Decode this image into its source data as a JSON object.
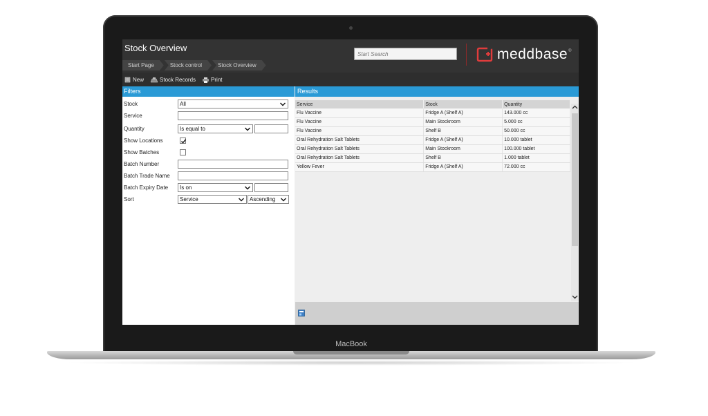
{
  "device": {
    "brand": "MacBook"
  },
  "header": {
    "title": "Stock Overview",
    "breadcrumb": [
      "Start Page",
      "Stock control",
      "Stock Overview"
    ],
    "search_placeholder": "Start Search",
    "logo_text": "meddbase",
    "logo_reg": "®",
    "accent_color": "#e03c3c"
  },
  "toolbar": {
    "new_label": "New",
    "stock_records_label": "Stock Records",
    "print_label": "Print"
  },
  "filters": {
    "title": "Filters",
    "stock": {
      "label": "Stock",
      "value": "All"
    },
    "service": {
      "label": "Service",
      "value": ""
    },
    "quantity": {
      "label": "Quantity",
      "operator": "Is equal to",
      "value": ""
    },
    "show_locations": {
      "label": "Show Locations",
      "checked": true
    },
    "show_batches": {
      "label": "Show Batches",
      "checked": false
    },
    "batch_number": {
      "label": "Batch Number",
      "value": ""
    },
    "batch_trade_name": {
      "label": "Batch Trade Name",
      "value": ""
    },
    "batch_expiry_date": {
      "label": "Batch Expiry Date",
      "operator": "Is on",
      "value": ""
    },
    "sort": {
      "label": "Sort",
      "field": "Service",
      "direction": "Ascending"
    }
  },
  "results": {
    "title": "Results",
    "columns": [
      "Service",
      "Stock",
      "Quantity"
    ],
    "rows": [
      [
        "Flu Vaccine",
        "Fridge A (Shelf A)",
        "143.000 cc"
      ],
      [
        "Flu Vaccine",
        "Main Stockroom",
        "5.000 cc"
      ],
      [
        "Flu Vaccine",
        "Shelf B",
        "50.000 cc"
      ],
      [
        "Oral Rehydration Salt Tablets",
        "Fridge A (Shelf A)",
        "10.000 tablet"
      ],
      [
        "Oral Rehydration Salt Tablets",
        "Main Stockroom",
        "100.000 tablet"
      ],
      [
        "Oral Rehydration Salt Tablets",
        "Shelf B",
        "1.000 tablet"
      ],
      [
        "Yellow Fever",
        "Fridge A (Shelf A)",
        "72.000 cc"
      ]
    ]
  }
}
